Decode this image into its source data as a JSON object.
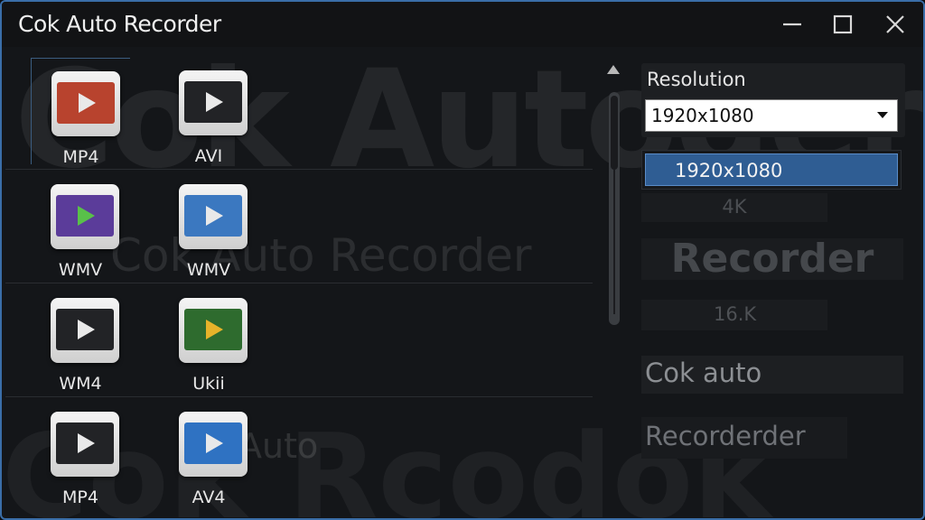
{
  "window": {
    "title": "Cok Auto Recorder",
    "accent": "#3a6ea8"
  },
  "watermarks": {
    "large": "Cok Autoder",
    "mid": "Cok Auto Recorder",
    "bottom": "Cok Rcodok",
    "small": "Auto"
  },
  "formats": [
    {
      "label": "MP4",
      "screen": "#b8432e",
      "play": "#e9e9e9"
    },
    {
      "label": "AVI",
      "screen": "#222326",
      "play": "#e9e9e9"
    },
    {
      "label": "WMV",
      "screen": "#5b3c9a",
      "play": "#59c04a"
    },
    {
      "label": "WMV",
      "screen": "#3b78c0",
      "play": "#e9e9e9"
    },
    {
      "label": "WM4",
      "screen": "#222326",
      "play": "#e9e9e9"
    },
    {
      "label": "Ukii",
      "screen": "#2e6b2e",
      "play": "#e6b32a"
    },
    {
      "label": "MP4",
      "screen": "#222326",
      "play": "#e9e9e9"
    },
    {
      "label": "AV4",
      "screen": "#2f72c2",
      "play": "#e9e9e9"
    }
  ],
  "resolution": {
    "label": "Resolution",
    "selected": "1920x1080",
    "options": [
      "1920x1080",
      "4K",
      "Recorder",
      "16.K",
      "Cok auto",
      "Recorderder"
    ],
    "highlight": "#2f5d93"
  }
}
